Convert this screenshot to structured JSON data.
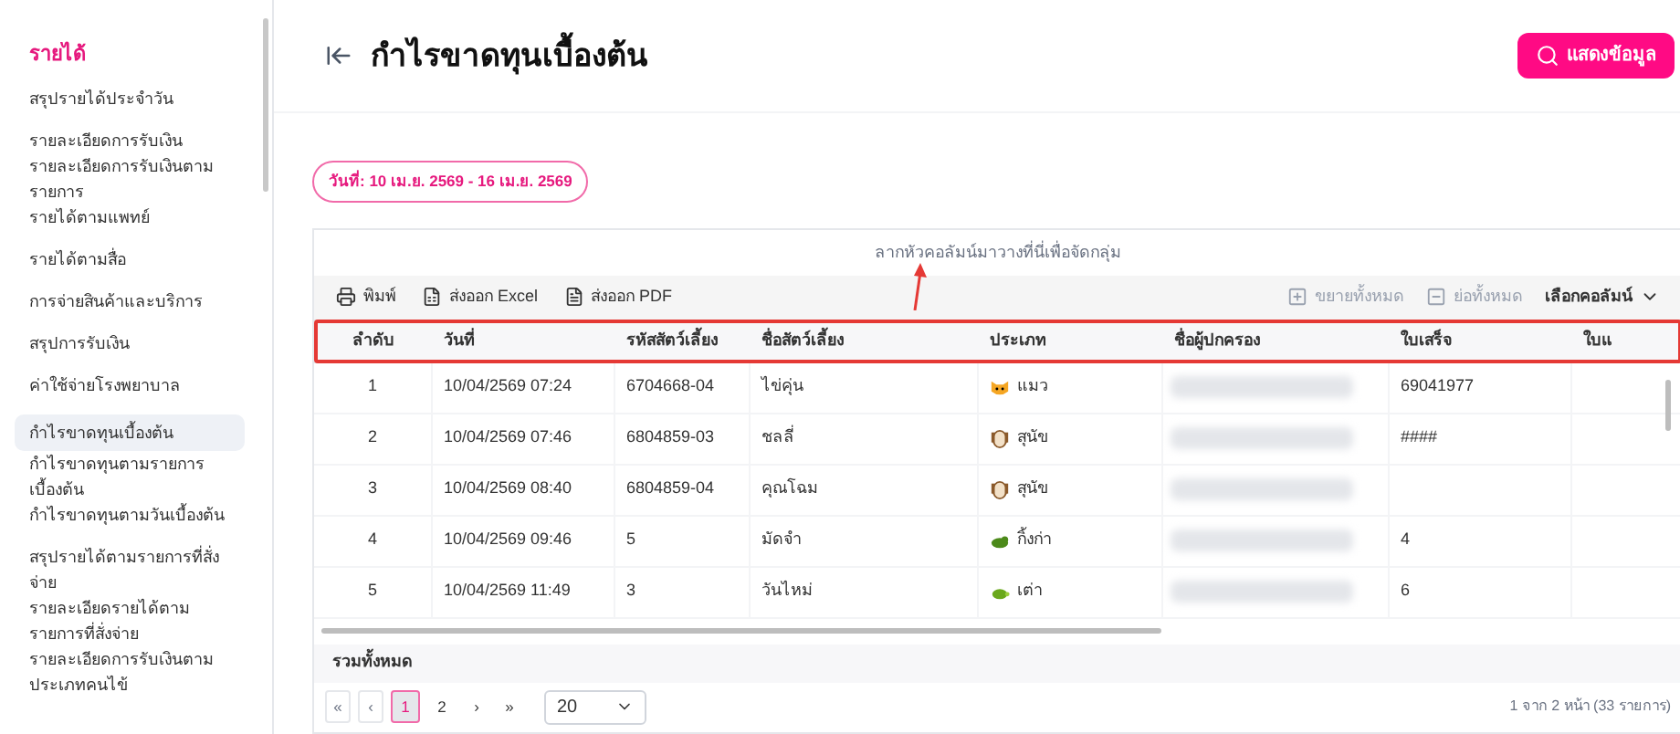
{
  "sidebar": {
    "heading": "รายได้",
    "groups": [
      [
        {
          "label": "สรุปรายได้ประจำวัน",
          "selected": false
        }
      ],
      [
        {
          "label": "รายละเอียดการรับเงิน",
          "selected": false
        },
        {
          "label": "รายละเอียดการรับเงินตามรายการ",
          "selected": false
        },
        {
          "label": "รายได้ตามแพทย์",
          "selected": false
        }
      ],
      [
        {
          "label": "รายได้ตามสื่อ",
          "selected": false
        }
      ],
      [
        {
          "label": "การจ่ายสินค้าและบริการ",
          "selected": false
        }
      ],
      [
        {
          "label": "สรุปการรับเงิน",
          "selected": false
        }
      ],
      [
        {
          "label": "ค่าใช้จ่ายโรงพยาบาล",
          "selected": false
        }
      ],
      [
        {
          "label": "กำไรขาดทุนเบื้องต้น",
          "selected": true
        },
        {
          "label": "กำไรขาดทุนตามรายการเบื้องต้น",
          "selected": false
        },
        {
          "label": "กำไรขาดทุนตามวันเบื้องต้น",
          "selected": false
        }
      ],
      [
        {
          "label": "สรุปรายได้ตามรายการที่สั่งจ่าย",
          "selected": false
        },
        {
          "label": "รายละเอียดรายได้ตามรายการที่สั่งจ่าย",
          "selected": false
        },
        {
          "label": "รายละเอียดการรับเงินตามประเภทคนไข้",
          "selected": false
        }
      ]
    ]
  },
  "header": {
    "title": "กำไรขาดทุนเบื้องต้น",
    "button": "แสดงข้อมูล"
  },
  "date_filter": "วันที่: 10 เม.ย. 2569 - 16 เม.ย. 2569",
  "grid": {
    "group_hint": "ลากหัวคอลัมน์มาวางที่นี่เพื่อจัดกลุ่ม",
    "toolbar_left": [
      {
        "kind": "print",
        "label": "พิมพ์"
      },
      {
        "kind": "excel",
        "label": "ส่งออก Excel"
      },
      {
        "kind": "pdf",
        "label": "ส่งออก PDF"
      }
    ],
    "toolbar_right": [
      {
        "kind": "expand",
        "label": "ขยายทั้งหมด",
        "disabled": true
      },
      {
        "kind": "collapse",
        "label": "ย่อทั้งหมด",
        "disabled": true
      }
    ],
    "column_chooser": "เลือกคอลัมน์",
    "columns": [
      "ลำดับ",
      "วันที่",
      "รหัสสัตว์เลี้ยง",
      "ชื่อสัตว์เลี้ยง",
      "ประเภท",
      "ชื่อผู้ปกครอง",
      "ใบเสร็จ",
      "ใบแ"
    ],
    "rows": [
      {
        "no": "1",
        "date": "10/04/2569 07:24",
        "pet_id": "6704668-04",
        "pet_name": "ไข่คุ่น",
        "type": {
          "kind": "cat",
          "label": "แมว"
        },
        "receipt": "69041977"
      },
      {
        "no": "2",
        "date": "10/04/2569 07:46",
        "pet_id": "6804859-03",
        "pet_name": "ชลลี่",
        "type": {
          "kind": "dog",
          "label": "สุนัข"
        },
        "receipt": "####"
      },
      {
        "no": "3",
        "date": "10/04/2569 08:40",
        "pet_id": "6804859-04",
        "pet_name": "คุณโฉม",
        "type": {
          "kind": "dog",
          "label": "สุนัข"
        }
      },
      {
        "no": "4",
        "date": "10/04/2569 09:46",
        "pet_id": "5",
        "pet_name": "มัดจำ",
        "type": {
          "kind": "lizard",
          "label": "กิ้งก่า"
        },
        "receipt": "4"
      },
      {
        "no": "5",
        "date": "10/04/2569 11:49",
        "pet_id": "3",
        "pet_name": "วันไหม่",
        "type": {
          "kind": "turtle",
          "label": "เต่า"
        },
        "receipt": "6"
      }
    ],
    "total_label": "รวมทั้งหมด",
    "pager": {
      "first": "«",
      "prev": "‹",
      "pages": [
        {
          "label": "1",
          "selected": true
        },
        {
          "label": "2",
          "selected": false
        }
      ],
      "next": "›",
      "last": "»",
      "page_size": "20",
      "info": "1 จาก 2 หน้า (33 รายการ)"
    }
  }
}
